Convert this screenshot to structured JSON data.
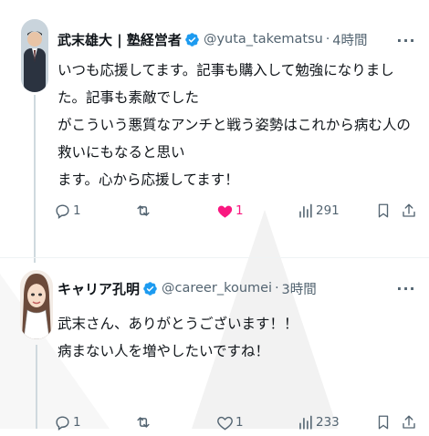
{
  "tweets": [
    {
      "name": "武末雄大 | 塾経営者",
      "handle": "@yuta_takematsu",
      "dot": "·",
      "time": "4時間",
      "text": "いつも応援してます。記事も購入して勉強になりました。記事も素敵でした\nがこういう悪質なアンチと戦う姿勢はこれから病む人の救いにもなると思い\nます。心から応援してます！",
      "reply_count": "1",
      "retweet_count": "",
      "like_count": "1",
      "views_count": "291",
      "liked": true
    },
    {
      "name": "キャリア孔明",
      "handle": "@career_koumei",
      "dot": "·",
      "time": "3時間",
      "text": "武末さん、ありがとうございます！！\n病まない人を増やしたいですね！",
      "reply_count": "1",
      "retweet_count": "",
      "like_count": "1",
      "views_count": "233",
      "liked": false
    }
  ],
  "icons": {
    "more": "more-dots-icon",
    "verified": "verified-badge-icon",
    "reply": "reply-icon",
    "retweet": "retweet-icon",
    "like": "heart-icon",
    "views": "views-chart-icon",
    "bookmark": "bookmark-icon",
    "share": "share-icon"
  },
  "colors": {
    "verified": "#1d9bf0",
    "liked": "#f91880",
    "secondary_text": "#536471",
    "primary_text": "#0f1419"
  },
  "more_label": "···"
}
